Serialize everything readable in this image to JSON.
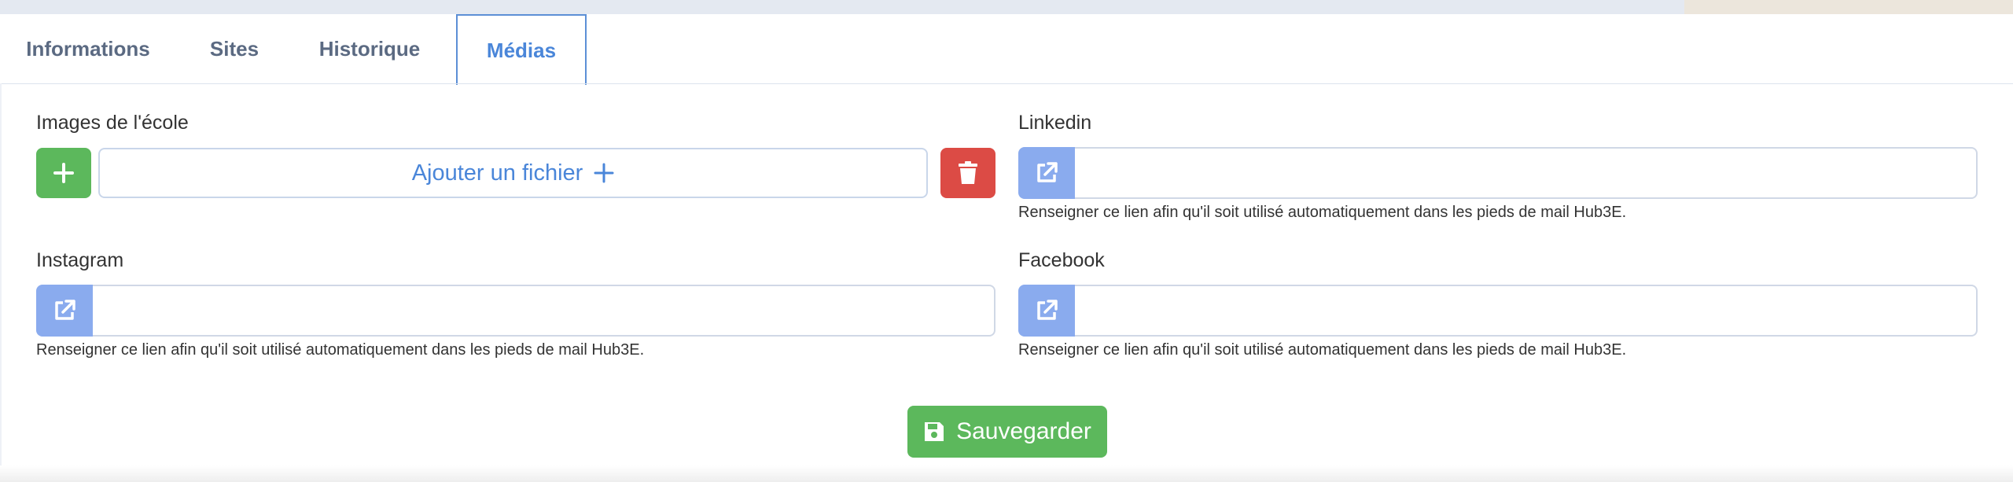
{
  "tabs": [
    {
      "label": "Informations",
      "active": false
    },
    {
      "label": "Sites",
      "active": false
    },
    {
      "label": "Historique",
      "active": false
    },
    {
      "label": "Médias",
      "active": true
    }
  ],
  "images": {
    "label": "Images de l'école",
    "add_file_label": "Ajouter un fichier"
  },
  "linkedin": {
    "label": "Linkedin",
    "value": "",
    "help": "Renseigner ce lien afin qu'il soit utilisé automatiquement dans les pieds de mail Hub3E."
  },
  "instagram": {
    "label": "Instagram",
    "value": "",
    "help": "Renseigner ce lien afin qu'il soit utilisé automatiquement dans les pieds de mail Hub3E."
  },
  "facebook": {
    "label": "Facebook",
    "value": "",
    "help": "Renseigner ce lien afin qu'il soit utilisé automatiquement dans les pieds de mail Hub3E."
  },
  "save_label": "Sauvegarder",
  "icons": {
    "add": "plus-icon",
    "delete": "trash-icon",
    "link": "external-link-icon",
    "save": "floppy-disk-icon"
  },
  "colors": {
    "primary": "#4a86d9",
    "success": "#5cb85c",
    "danger": "#dc4b45",
    "addon": "#8aabee"
  }
}
